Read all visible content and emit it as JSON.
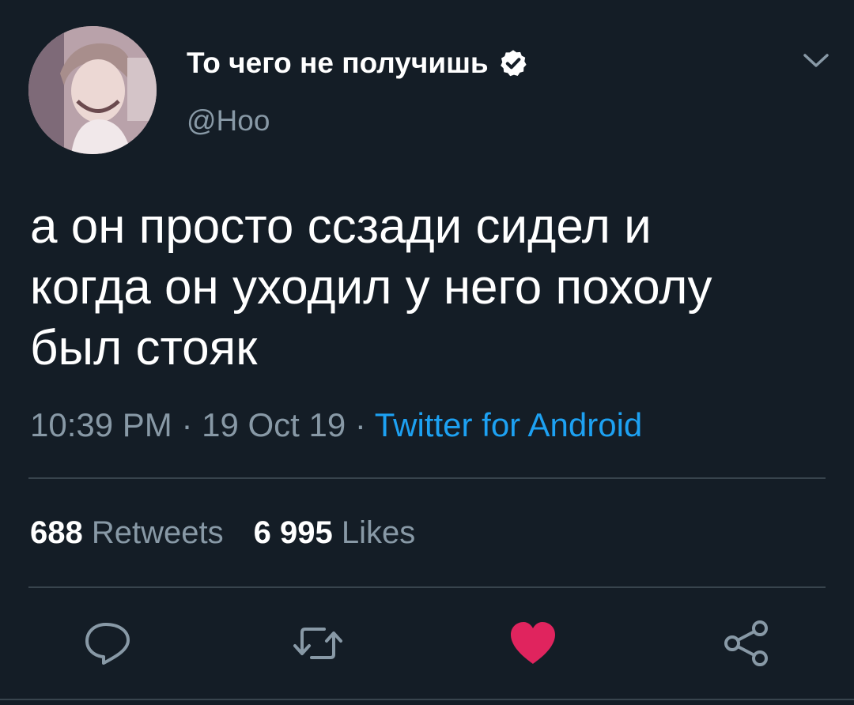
{
  "author": {
    "display_name": "То чего не получишь",
    "handle": "@Hoo",
    "verified": true
  },
  "tweet": {
    "text": "а он просто ссзади сидел и\nкогда он уходил у него похолу\nбыл стояк",
    "time": "10:39 PM",
    "separator": " · ",
    "date": "19 Oct 19",
    "source": "Twitter for Android"
  },
  "stats": {
    "retweets_count": "688",
    "retweets_label": "Retweets",
    "likes_count": "6 995",
    "likes_label": "Likes"
  },
  "actions": {
    "reply_icon": "reply-icon",
    "retweet_icon": "retweet-icon",
    "like_icon": "heart-icon",
    "share_icon": "share-icon",
    "liked": true
  },
  "colors": {
    "background": "#141d26",
    "secondary_text": "#8899a6",
    "link": "#1da1f2",
    "like": "#e0245e",
    "divider": "#38444d"
  }
}
